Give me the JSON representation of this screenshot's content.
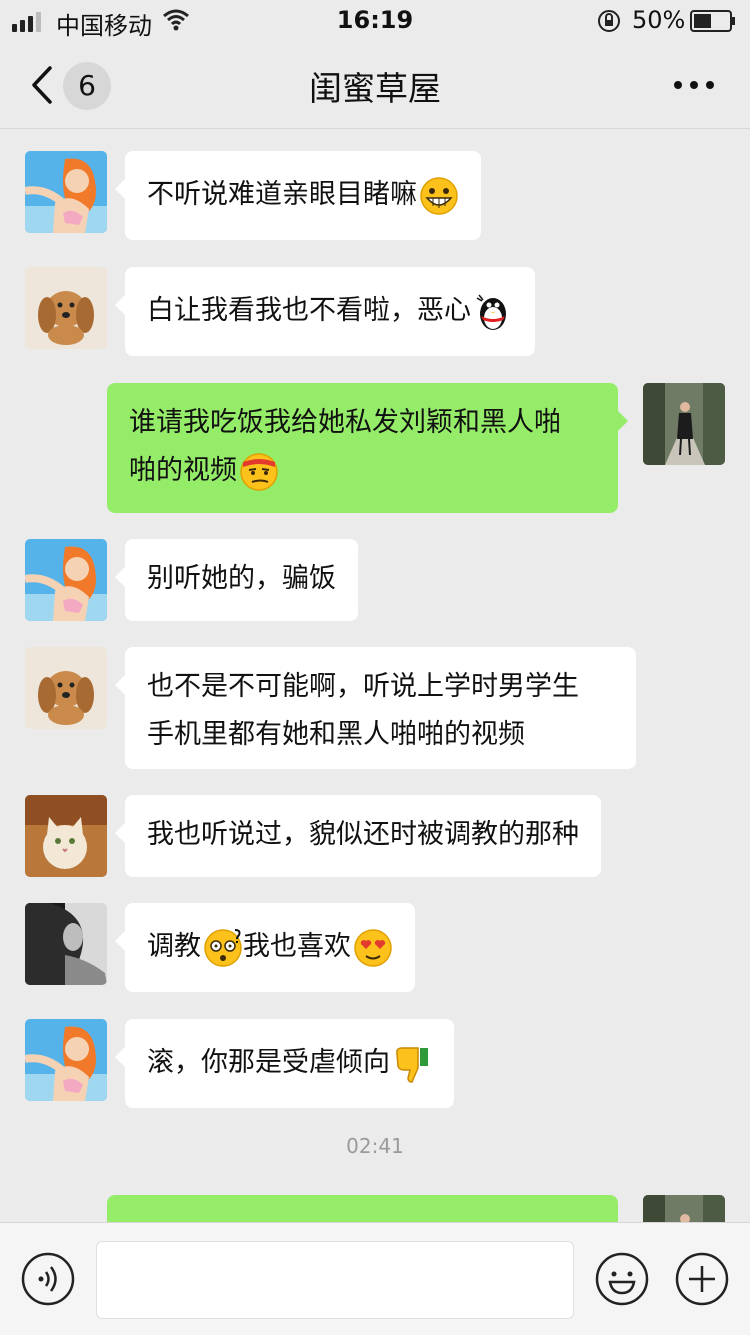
{
  "status_bar": {
    "carrier": "中国移动",
    "time": "16:19",
    "battery_percent": "50%",
    "battery_level": 0.5
  },
  "header": {
    "back_label": "返回",
    "unread_count": "6",
    "title": "闺蜜草屋",
    "more_label": "更多"
  },
  "messages": [
    {
      "text": "不听说难道亲眼目睹嘛",
      "emoji": "grin-emoji",
      "direction": "in"
    },
    {
      "text": "白让我看我也不看啦，恶心",
      "emoji": "qq-penguin-emoji",
      "direction": "in"
    },
    {
      "text": "谁请我吃饭我给她私发刘颖和黑人啪\n啪的视频",
      "emoji": "smirk-emoji",
      "direction": "out"
    },
    {
      "text": "别听她的，骗饭",
      "direction": "in"
    },
    {
      "text": "也不是不可能啊，听说上学时男学生\n手机里都有她和黑人啪啪的视频",
      "direction": "in"
    },
    {
      "text": "我也听说过，貌似还时被调教的那种",
      "direction": "in"
    },
    {
      "text_before": "调教",
      "emoji": "dizzy-emoji",
      "text_after": "我也喜欢",
      "emoji2": "heart-eyes-emoji",
      "direction": "in"
    },
    {
      "text": "滚，你那是受虐倾向",
      "emoji": "thumbs-down-emoji",
      "direction": "in"
    },
    {
      "text": "",
      "direction": "out"
    }
  ],
  "timestamp": "02:41",
  "input": {
    "value": "",
    "placeholder": ""
  },
  "colors": {
    "background": "#ebebeb",
    "bubble_in": "#ffffff",
    "bubble_out": "#95ec69"
  }
}
